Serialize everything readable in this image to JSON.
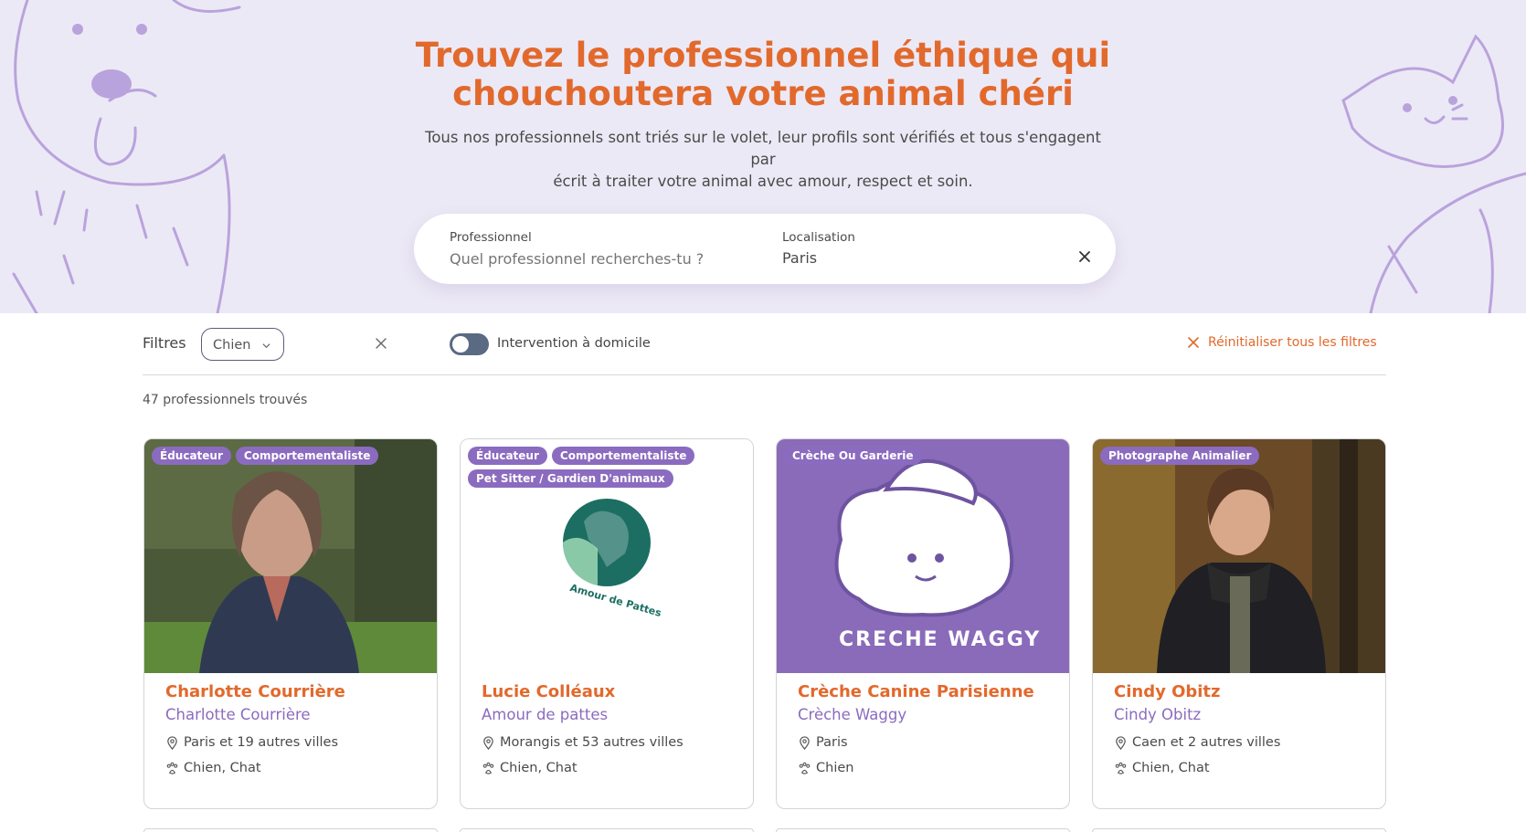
{
  "hero": {
    "title_line1": "Trouvez le professionnel éthique qui",
    "title_line2": "chouchoutera votre animal chéri",
    "subtitle_line1": "Tous nos professionnels sont triés sur le volet, leur profils sont vérifiés et tous s'engagent par",
    "subtitle_line2": "écrit à traiter votre animal avec amour, respect et soin."
  },
  "search": {
    "professional_label": "Professionnel",
    "professional_placeholder": "Quel professionnel recherches-tu ?",
    "location_label": "Localisation",
    "location_value": "Paris"
  },
  "filters": {
    "label": "Filtres",
    "species_selected": "Chien",
    "home_toggle_label": "Intervention à domicile",
    "home_toggle_on": false,
    "reset_label": "Réinitialiser tous les filtres",
    "results_count": "47 professionnels trouvés"
  },
  "colors": {
    "accent_orange": "#e2692c",
    "accent_purple": "#8b6bbf",
    "hero_bg": "#ece9f6"
  },
  "cards": [
    {
      "tags": [
        "Éducateur",
        "Comportementaliste"
      ],
      "name": "Charlotte Courrière",
      "company": "Charlotte Courrière",
      "location": "Paris et 19 autres villes",
      "species": "Chien, Chat"
    },
    {
      "tags": [
        "Éducateur",
        "Comportementaliste",
        "Pet Sitter / Gardien D'animaux"
      ],
      "logo_text": "Amour de Pattes",
      "name": "Lucie Colléaux",
      "company": "Amour de pattes",
      "location": "Morangis et 53 autres villes",
      "species": "Chien, Chat"
    },
    {
      "tags": [
        "Crèche Ou Garderie"
      ],
      "logo_text": "CRECHE WAGGY",
      "name": "Crèche Canine Parisienne",
      "company": "Crèche Waggy",
      "location": "Paris",
      "species": "Chien"
    },
    {
      "tags": [
        "Photographe Animalier"
      ],
      "name": "Cindy Obitz",
      "company": "Cindy Obitz",
      "location": "Caen et 2 autres villes",
      "species": "Chien, Chat"
    }
  ]
}
